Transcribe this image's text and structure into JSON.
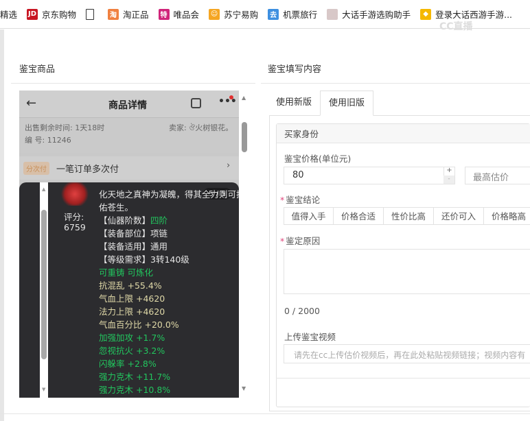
{
  "bookmarks": [
    {
      "label": "精选",
      "icon": "none"
    },
    {
      "label": "京东购物",
      "icon": "jd-icon",
      "color": "#c81623",
      "glyph": "JD"
    },
    {
      "label": "",
      "icon": "page-icon"
    },
    {
      "label": "淘正品",
      "icon": "taozhengpin-icon",
      "color": "#f08040",
      "glyph": "淘"
    },
    {
      "label": "唯品会",
      "icon": "vip-icon",
      "color": "#d0247a",
      "glyph": "特"
    },
    {
      "label": "苏宁易购",
      "icon": "suning-icon",
      "color": "#f5a623",
      "glyph": "☺"
    },
    {
      "label": "机票旅行",
      "icon": "flight-icon",
      "color": "#3d8fe0",
      "glyph": "去"
    },
    {
      "label": "大话手游选购助手",
      "icon": "dahua-icon",
      "color": "#d8c8c8",
      "glyph": ""
    },
    {
      "label": "登录大话西游手游...",
      "icon": "chick-icon",
      "color": "#f5b800",
      "glyph": "◆"
    }
  ],
  "watermark": "CC直播",
  "left": {
    "title": "鉴宝商品"
  },
  "phone": {
    "header_title": "商品详情",
    "remaining_time": "出售剩余时间: 1天18时",
    "seller": "卖家: ঔ火树银花。",
    "serial": "编 号: 11246",
    "installment_badge": "分次付",
    "installment_text": "一笔订单多次付",
    "page_indicator": "5 / 5",
    "score_label": "评分:",
    "score_value": "6759",
    "lines": [
      {
        "text": "化天地之真神为凝魄，得其全力则可护",
        "color": "w"
      },
      {
        "text": "佑苍生。",
        "color": "w"
      },
      {
        "text": "【仙器阶数】",
        "color": "w",
        "extra": "四阶"
      },
      {
        "text": "【装备部位】项链",
        "color": "w"
      },
      {
        "text": "【装备适用】通用",
        "color": "w"
      },
      {
        "text": "【等级需求】3转140级",
        "color": "w"
      },
      {
        "text": "可重铸 可炼化",
        "color": "g"
      },
      {
        "text": "抗混乱 +55.4%",
        "color": "y"
      },
      {
        "text": "气血上限 +4620",
        "color": "y"
      },
      {
        "text": "法力上限 +4620",
        "color": "y"
      },
      {
        "text": "气血百分比 +20.0%",
        "color": "y"
      },
      {
        "text": "加强加攻 +1.7%",
        "color": "g"
      },
      {
        "text": "忽视抗火 +3.2%",
        "color": "g"
      },
      {
        "text": "闪躲率 +2.8%",
        "color": "g"
      },
      {
        "text": "强力克木 +11.7%",
        "color": "g"
      },
      {
        "text": "强力克木 +10.8%",
        "color": "g"
      }
    ]
  },
  "right": {
    "title": "鉴宝填写内容",
    "tabs": [
      "使用新版",
      "使用旧版"
    ],
    "active_tab": 1,
    "section_title": "买家身份",
    "price_label": "鉴宝价格(单位元)",
    "price_value": "80",
    "max_price_placeholder": "最高估价",
    "conclusion_label": "鉴宝结论",
    "conclusions": [
      "值得入手",
      "价格合适",
      "性价比高",
      "还价可入",
      "价格略高"
    ],
    "reason_label": "鉴定原因",
    "counter": "0 / 2000",
    "video_label": "上传鉴宝视频",
    "video_placeholder": "请先在cc上传估价视频后，再在此处粘贴视频链接；视频内容有"
  }
}
